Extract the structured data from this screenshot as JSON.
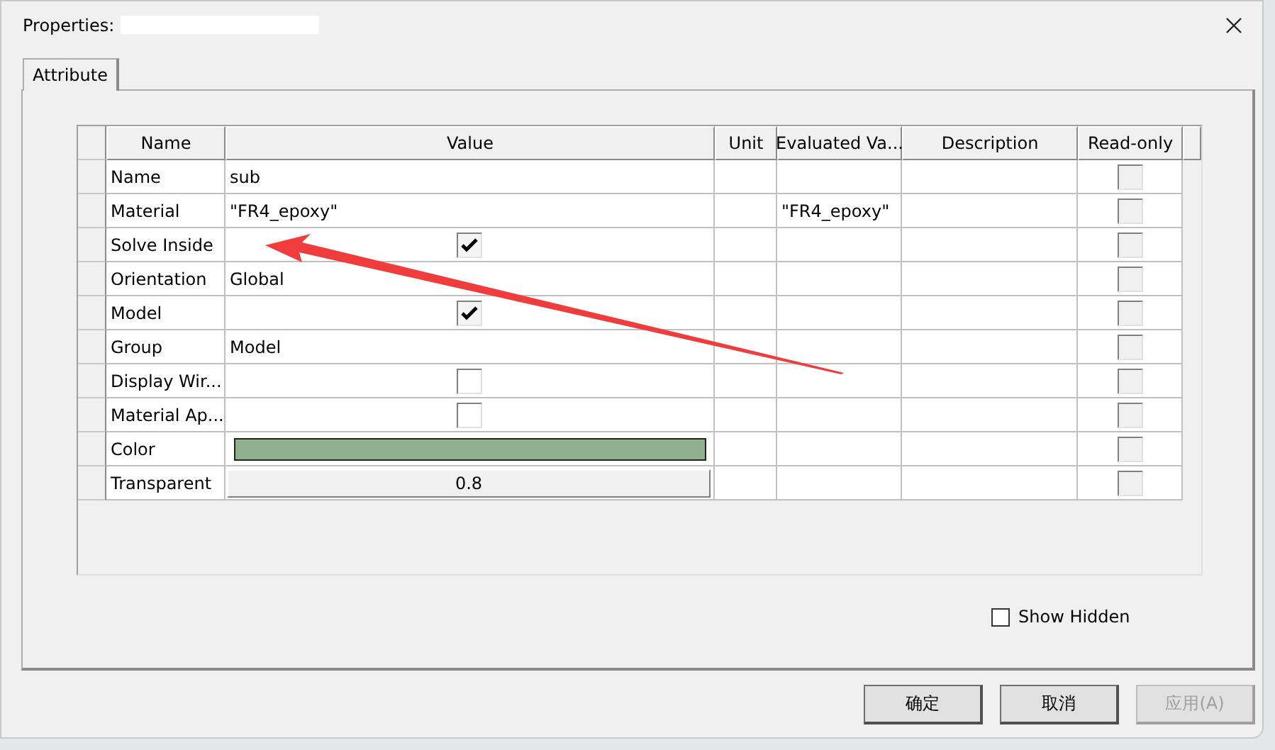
{
  "window": {
    "title": "Properties:"
  },
  "tabs": [
    {
      "label": "Attribute",
      "selected": true
    }
  ],
  "table": {
    "columns": [
      "Name",
      "Value",
      "Unit",
      "Evaluated Va...",
      "Description",
      "Read-only"
    ],
    "rows": [
      {
        "name": "Name",
        "kind": "text",
        "value": "sub",
        "read_only": false
      },
      {
        "name": "Material",
        "kind": "text",
        "value": "\"FR4_epoxy\"",
        "evaluated": "\"FR4_epoxy\"",
        "read_only": false
      },
      {
        "name": "Solve Inside",
        "kind": "checkbox",
        "checked": true,
        "read_only": false
      },
      {
        "name": "Orientation",
        "kind": "text",
        "value": "Global",
        "read_only": false
      },
      {
        "name": "Model",
        "kind": "checkbox",
        "checked": true,
        "read_only": false
      },
      {
        "name": "Group",
        "kind": "text",
        "value": "Model",
        "read_only": false
      },
      {
        "name": "Display Wir...",
        "kind": "checkbox",
        "checked": false,
        "read_only": false
      },
      {
        "name": "Material Ap...",
        "kind": "checkbox",
        "checked": false,
        "read_only": false
      },
      {
        "name": "Color",
        "kind": "color",
        "color": "#8faf8d",
        "read_only": false
      },
      {
        "name": "Transparent",
        "kind": "number",
        "value": "0.8",
        "read_only": false
      }
    ]
  },
  "show_hidden": {
    "label": "Show Hidden",
    "checked": false
  },
  "buttons": [
    {
      "label": "确定",
      "disabled": false
    },
    {
      "label": "取消",
      "disabled": false
    },
    {
      "label": "应用(A)",
      "disabled": true
    }
  ]
}
